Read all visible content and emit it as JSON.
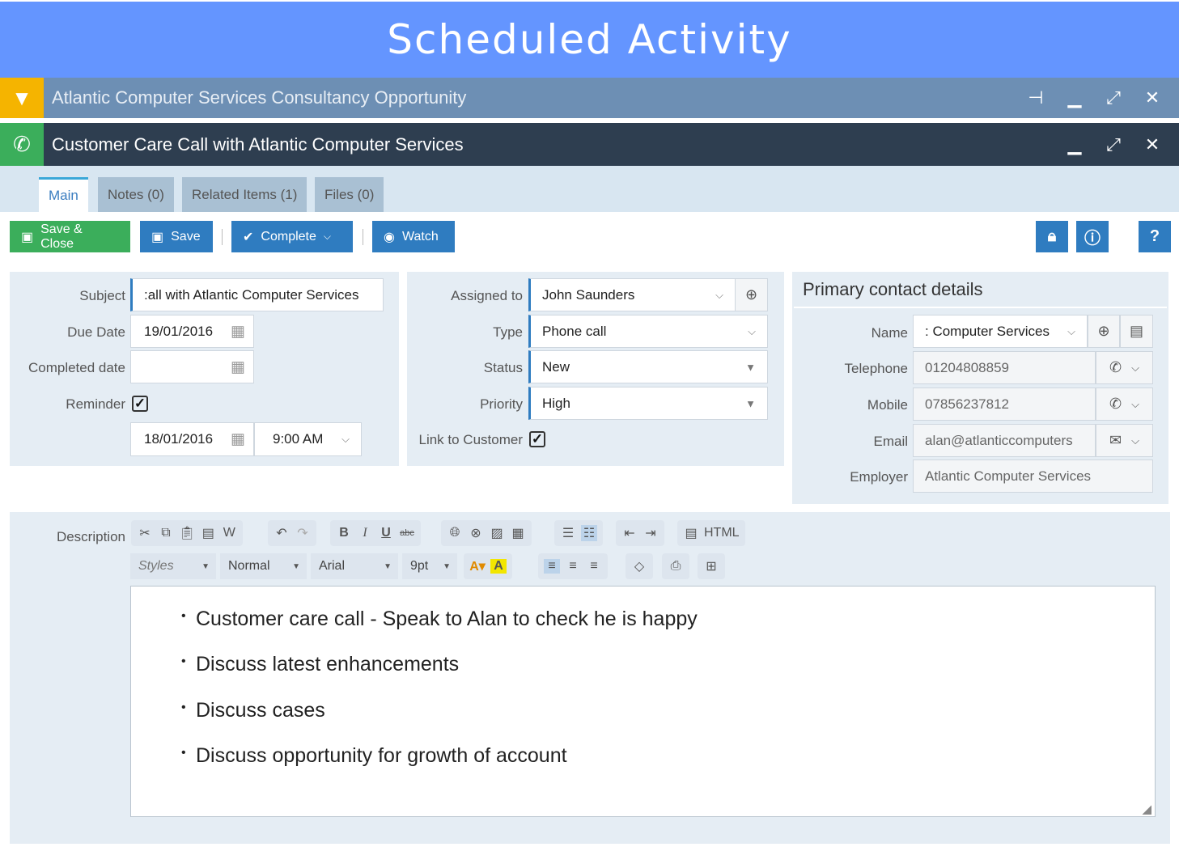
{
  "banner_title": "Scheduled Activity",
  "windows": [
    {
      "title": "Atlantic Computer Services Consultancy Opportunity",
      "icon": "filter-icon",
      "accent": "#f5b400"
    },
    {
      "title": "Customer Care Call with Atlantic Computer Services",
      "icon": "phone-icon",
      "accent": "#3bae5b"
    }
  ],
  "tabs": [
    "Main",
    "Notes (0)",
    "Related Items (1)",
    "Files (0)"
  ],
  "toolbar": {
    "save_close": "Save & Close",
    "save": "Save",
    "complete": "Complete",
    "watch": "Watch"
  },
  "form": {
    "subject_label": "Subject",
    "subject": ":all with Atlantic Computer Services",
    "due_date_label": "Due Date",
    "due_date": "19/01/2016",
    "completed_date_label": "Completed date",
    "completed_date": "",
    "reminder_label": "Reminder",
    "reminder_date": "18/01/2016",
    "reminder_time": "9:00 AM",
    "assigned_label": "Assigned to",
    "assigned": "John Saunders",
    "type_label": "Type",
    "type": "Phone call",
    "status_label": "Status",
    "status": "New",
    "priority_label": "Priority",
    "priority": "High",
    "link_label": "Link to Customer"
  },
  "contact": {
    "heading": "Primary contact details",
    "name_label": "Name",
    "name": ": Computer Services",
    "telephone_label": "Telephone",
    "telephone": "01204808859",
    "mobile_label": "Mobile",
    "mobile": "07856237812",
    "email_label": "Email",
    "email": "alan@atlanticcomputers",
    "employer_label": "Employer",
    "employer": "Atlantic Computer Services"
  },
  "editor": {
    "description_label": "Description",
    "html_label": "HTML",
    "styles": "Styles",
    "format": "Normal",
    "font": "Arial",
    "size": "9pt",
    "bullets": [
      "Customer care call - Speak to Alan to check he is happy",
      "Discuss latest enhancements",
      "Discuss cases",
      "Discuss opportunity for growth of account"
    ]
  }
}
